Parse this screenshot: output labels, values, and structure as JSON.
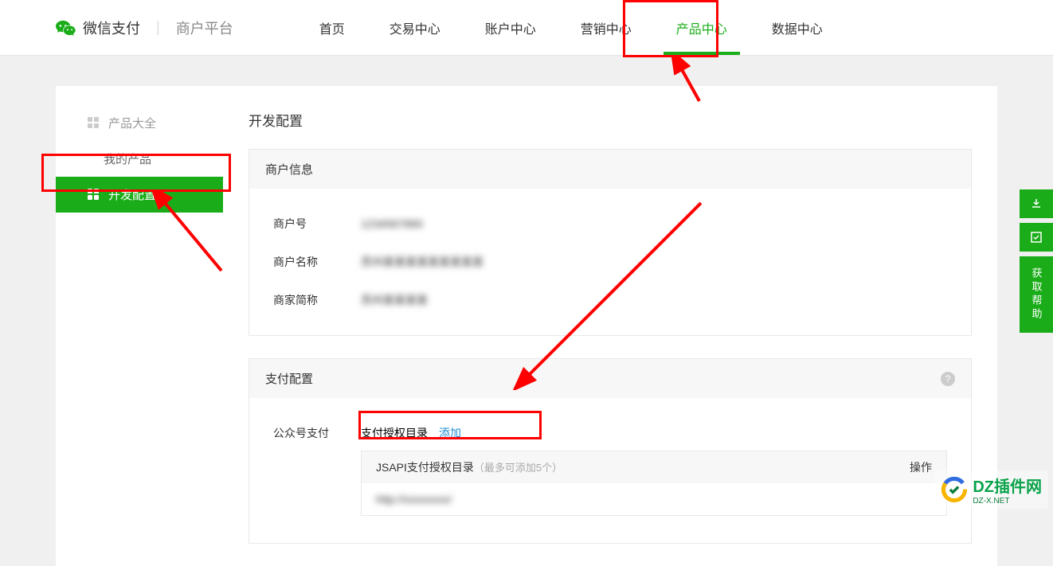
{
  "header": {
    "brand": "微信支付",
    "sub": "商户平台",
    "nav": [
      "首页",
      "交易中心",
      "账户中心",
      "营销中心",
      "产品中心",
      "数据中心"
    ],
    "active_index": 4
  },
  "sidebar": {
    "items": [
      {
        "label": "产品大全",
        "type": "head"
      },
      {
        "label": "我的产品",
        "type": "sub"
      },
      {
        "label": "开发配置",
        "type": "active"
      }
    ]
  },
  "page": {
    "title": "开发配置"
  },
  "merchant": {
    "section_title": "商户信息",
    "rows": [
      {
        "label": "商户号",
        "value": "1234567890"
      },
      {
        "label": "商户名称",
        "value": "苏州某某某某某某某某某"
      },
      {
        "label": "商家简称",
        "value": "苏州某某某某"
      }
    ]
  },
  "payconfig": {
    "section_title": "支付配置",
    "pub_label": "公众号支付",
    "auth_dir_label": "支付授权目录",
    "add_link": "添加",
    "table": {
      "head": "JSAPI支付授权目录",
      "hint": "（最多可添加5个）",
      "op": "操作",
      "row1": "http://xxxxxxxx/"
    }
  },
  "float": {
    "help": "获取帮助"
  },
  "watermark": {
    "main": "DZ插件网",
    "sub": "DZ-X.NET"
  }
}
